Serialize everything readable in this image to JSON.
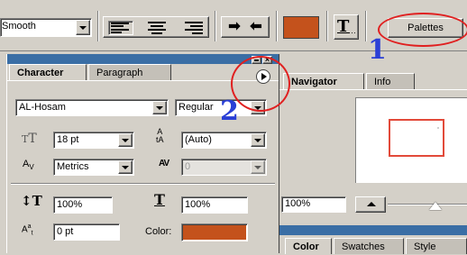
{
  "toolbar": {
    "antialias_value": "Smooth",
    "align_left": "align-left",
    "align_center": "align-center",
    "align_right": "align-right",
    "text_color": "#c4521c",
    "palettes_label": "Palettes"
  },
  "character_panel": {
    "tabs": [
      "Character",
      "Paragraph"
    ],
    "font_family": "AL-Hosam",
    "font_style": "Regular",
    "font_size": "18 pt",
    "leading": "(Auto)",
    "kerning": "Metrics",
    "tracking": "0",
    "vertical_scale": "100%",
    "horizontal_scale": "100%",
    "baseline_shift": "0 pt",
    "color_label": "Color:",
    "color_swatch": "#c4521c"
  },
  "navigator_panel": {
    "tabs": [
      "Navigator",
      "Info"
    ],
    "zoom": "100%",
    "view_box_color": "#e24a3a"
  },
  "color_panel": {
    "tabs": [
      "Color",
      "Swatches",
      "Style"
    ]
  },
  "annotations": {
    "one": "1",
    "two": "2",
    "color": "#e02020"
  }
}
